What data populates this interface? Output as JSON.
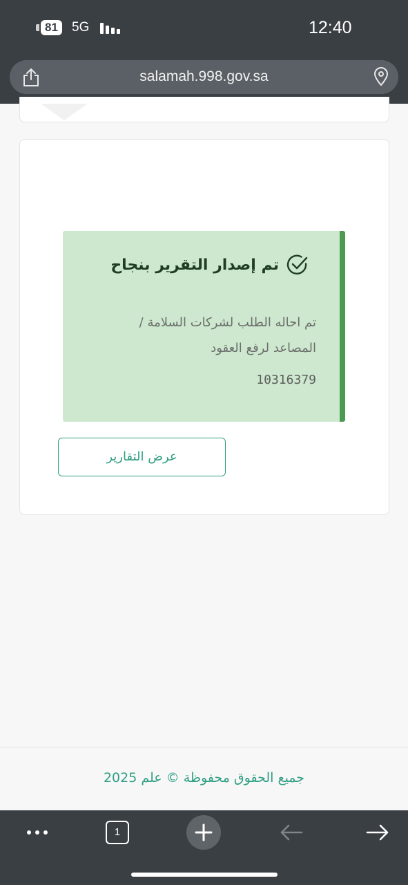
{
  "status_bar": {
    "battery": "81",
    "network": "5G",
    "time": "12:40"
  },
  "browser": {
    "url": "salamah.998.gov.sa",
    "share_icon": "share-icon",
    "location_icon": "location-pin-icon",
    "tab_count": "1"
  },
  "alert": {
    "title": "تم إصدار التقرير بنجاح",
    "message": "تم احاله الطلب لشركات السلامة / المصاعد لرفع العقود",
    "reference": "10316379",
    "icon": "check-circle-icon",
    "background_color": "#cde8cf",
    "border_color": "#4b9a52"
  },
  "actions": {
    "view_reports": "عرض التقارير"
  },
  "footer": {
    "copyright": "جميع الحقوق محفوظة © علم 2025"
  },
  "toolbar": {
    "icons": [
      "more-icon",
      "tabs-icon",
      "new-tab-icon",
      "back-arrow-icon",
      "forward-arrow-icon"
    ]
  },
  "colors": {
    "accent": "#2f9e82",
    "chrome": "#3a3f44"
  }
}
